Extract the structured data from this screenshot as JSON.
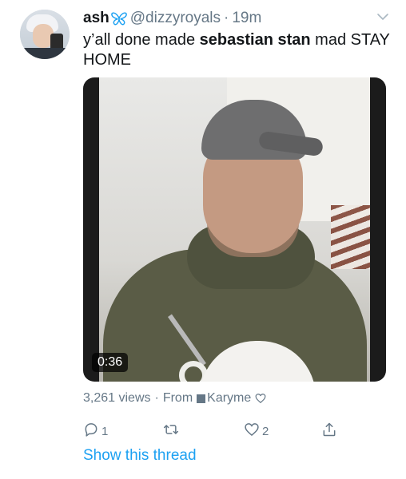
{
  "tweet": {
    "author_name": "ash",
    "handle": "@dizzyroyals",
    "separator": "·",
    "time": "19m",
    "text_part1": "y’all done made ",
    "text_bold": "sebastian stan",
    "text_part2": " mad STAY HOME"
  },
  "media": {
    "duration": "0:36"
  },
  "meta": {
    "views": "3,261 views",
    "separator": "·",
    "from_label": "From",
    "source": "Karyme"
  },
  "actions": {
    "reply_count": "1",
    "retweet_count": "",
    "like_count": "2"
  },
  "thread_link": "Show this thread",
  "icons": {
    "verified_like": "butterfly-icon",
    "caret": "chevron-down-icon",
    "reply": "reply-icon",
    "retweet": "retweet-icon",
    "like": "heart-icon",
    "share": "share-icon"
  },
  "colors": {
    "text": "#14171a",
    "secondary": "#657786",
    "link": "#1da1f2",
    "butterfly": "#1da1f2"
  }
}
